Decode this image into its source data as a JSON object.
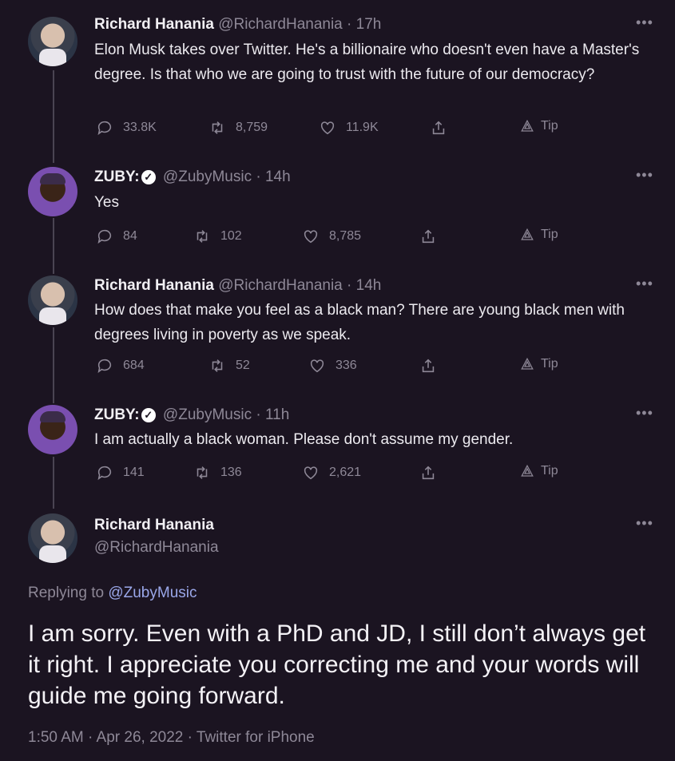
{
  "tweets": [
    {
      "name": "Richard Hanania",
      "handle": "@RichardHanania",
      "time": "· 17h",
      "text": "Elon Musk takes over Twitter. He's a billionaire who doesn't even have a Master's degree. Is that who we are going to trust with the future of our democracy?",
      "replies": "33.8K",
      "retweets": "8,759",
      "likes": "11.9K",
      "tip": "Tip"
    },
    {
      "name": "ZUBY:",
      "handle": "@ZubyMusic",
      "time": "· 14h",
      "text": "Yes",
      "replies": "84",
      "retweets": "102",
      "likes": "8,785",
      "tip": "Tip"
    },
    {
      "name": "Richard Hanania",
      "handle": "@RichardHanania",
      "time": "· 14h",
      "text": "How does that make you feel as a black man? There are young black men with degrees living in poverty as we speak.",
      "replies": "684",
      "retweets": "52",
      "likes": "336",
      "tip": "Tip"
    },
    {
      "name": "ZUBY:",
      "handle": "@ZubyMusic",
      "time": "· 11h",
      "text": "I am actually a black woman. Please don't assume my gender.",
      "replies": "141",
      "retweets": "136",
      "likes": "2,621",
      "tip": "Tip"
    }
  ],
  "main": {
    "name": "Richard Hanania",
    "handle": "@RichardHanania",
    "replying_prefix": "Replying to ",
    "replying_to": "@ZubyMusic",
    "text": "I am sorry. Even with a PhD and JD, I still don’t always get it right. I appreciate you correcting me and your words will guide me going forward.",
    "meta": "1:50 AM · Apr 26, 2022 · Twitter for iPhone"
  },
  "more_icon": "•••",
  "verified_icon": "✓",
  "colors": {
    "background": "#1b1421",
    "muted": "#8e8897",
    "link": "#9aa7e9"
  }
}
